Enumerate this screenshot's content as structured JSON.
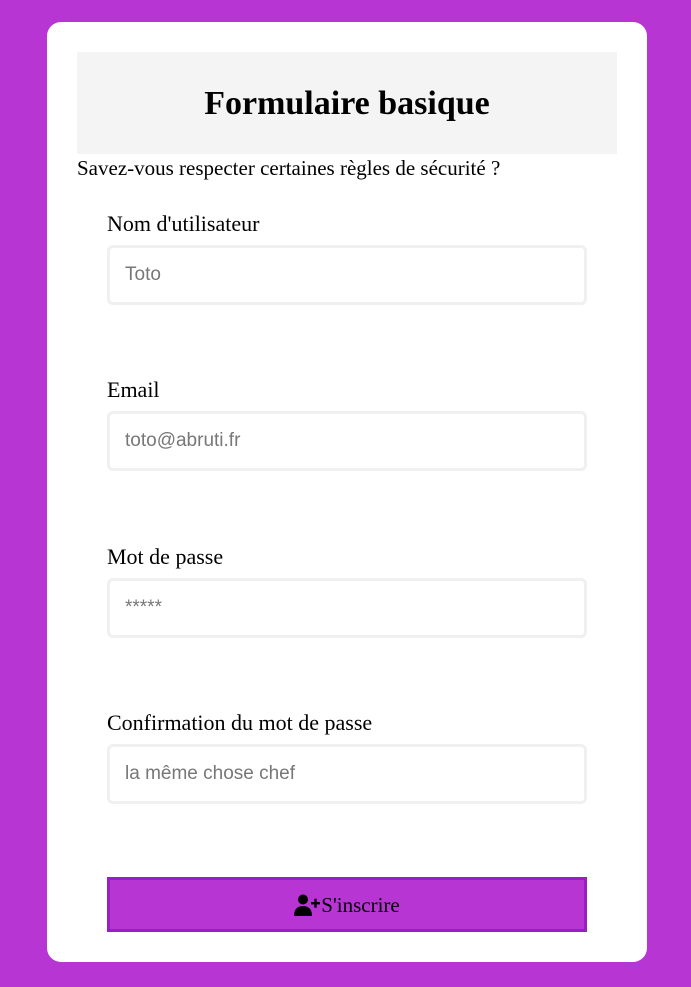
{
  "colors": {
    "background": "#b735d3",
    "card": "#ffffff",
    "header_bg": "#f4f4f4",
    "button_bg": "#b735d3",
    "button_border": "#9a1fc2"
  },
  "form": {
    "title": "Formulaire basique",
    "subtitle": "Savez-vous respecter certaines règles de sécurité ?",
    "fields": [
      {
        "label": "Nom d'utilisateur",
        "placeholder": "Toto",
        "type": "text"
      },
      {
        "label": "Email",
        "placeholder": "toto@abruti.fr",
        "type": "email"
      },
      {
        "label": "Mot de passe",
        "placeholder": "*****",
        "type": "password"
      },
      {
        "label": "Confirmation du mot de passe",
        "placeholder": "la même chose chef",
        "type": "password"
      }
    ],
    "submit": {
      "label": "S'inscrire",
      "icon": "user-plus-icon"
    }
  }
}
